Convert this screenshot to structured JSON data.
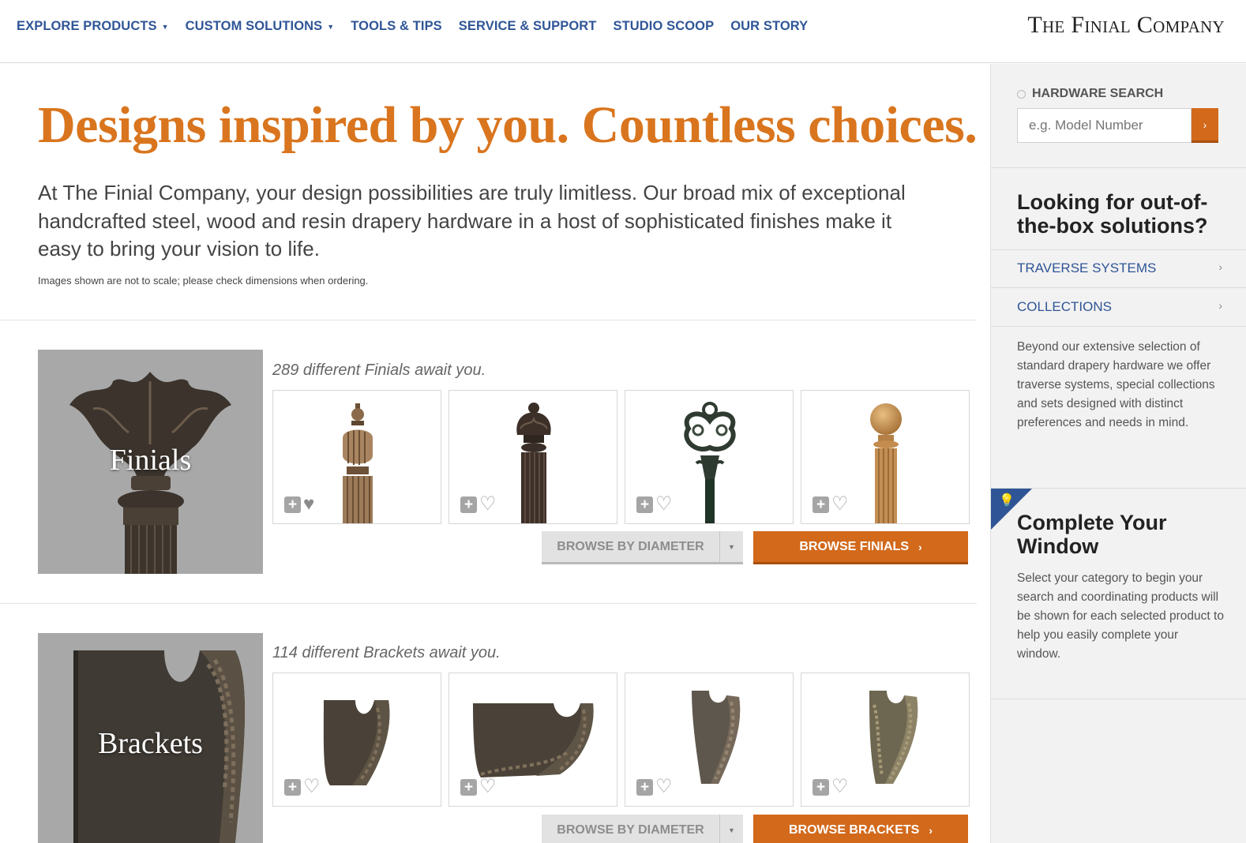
{
  "nav": {
    "items": [
      {
        "label": "EXPLORE PRODUCTS",
        "dropdown": true
      },
      {
        "label": "CUSTOM SOLUTIONS",
        "dropdown": true
      },
      {
        "label": "TOOLS & TIPS",
        "dropdown": false
      },
      {
        "label": "SERVICE & SUPPORT",
        "dropdown": false
      },
      {
        "label": "STUDIO SCOOP",
        "dropdown": false
      },
      {
        "label": "OUR STORY",
        "dropdown": false
      }
    ],
    "brand": "The Finial Company"
  },
  "main": {
    "headline": "Designs inspired by you. Countless choices.",
    "intro": "At The Finial Company, your design possibilities are truly limitless. Our broad mix of exceptional handcrafted steel, wood and resin drapery hardware in a host of sophisticated finishes make it easy to bring your vision to life.",
    "note": "Images shown are not to scale; please check dimensions when ordering.",
    "categories": [
      {
        "name": "Finials",
        "count_text": "289 different Finials await you.",
        "browse_diameter": "BROWSE BY DIAMETER",
        "browse_label": "BROWSE FINIALS",
        "products": [
          {
            "kind": "urn-finial",
            "favorited": true
          },
          {
            "kind": "crown-finial",
            "favorited": false
          },
          {
            "kind": "key-finial",
            "favorited": false
          },
          {
            "kind": "ball-finial",
            "favorited": false
          }
        ]
      },
      {
        "name": "Brackets",
        "count_text": "114 different Brackets await you.",
        "browse_diameter": "BROWSE BY DIAMETER",
        "browse_label": "BROWSE BRACKETS",
        "products": [
          {
            "kind": "short-bracket",
            "favorited": false
          },
          {
            "kind": "long-bracket",
            "favorited": false
          },
          {
            "kind": "tall-bracket",
            "favorited": false
          },
          {
            "kind": "ornate-bracket",
            "favorited": false
          }
        ]
      }
    ]
  },
  "sidebar": {
    "search_label": "HARDWARE SEARCH",
    "search_placeholder": "e.g. Model Number",
    "search_go": "›",
    "solutions_heading": "Looking for out-of-the-box solutions?",
    "links": [
      {
        "label": "TRAVERSE SYSTEMS"
      },
      {
        "label": "COLLECTIONS"
      }
    ],
    "solutions_text": "Beyond our extensive selection of standard drapery hardware we offer traverse systems, special collections and sets designed with distinct preferences and needs in mind.",
    "window_heading": "Complete Your Window",
    "window_text": "Select your category to begin your search and coordinating products will be shown for each selected product to help you easily complete your window."
  },
  "icons": {
    "add": "plus-square-icon",
    "favorite": "heart-icon",
    "search": "magnifier-icon",
    "tip": "lightbulb-icon"
  },
  "colors": {
    "accent": "#d2691b",
    "headline": "#d9751e",
    "nav": "#2f5596"
  }
}
